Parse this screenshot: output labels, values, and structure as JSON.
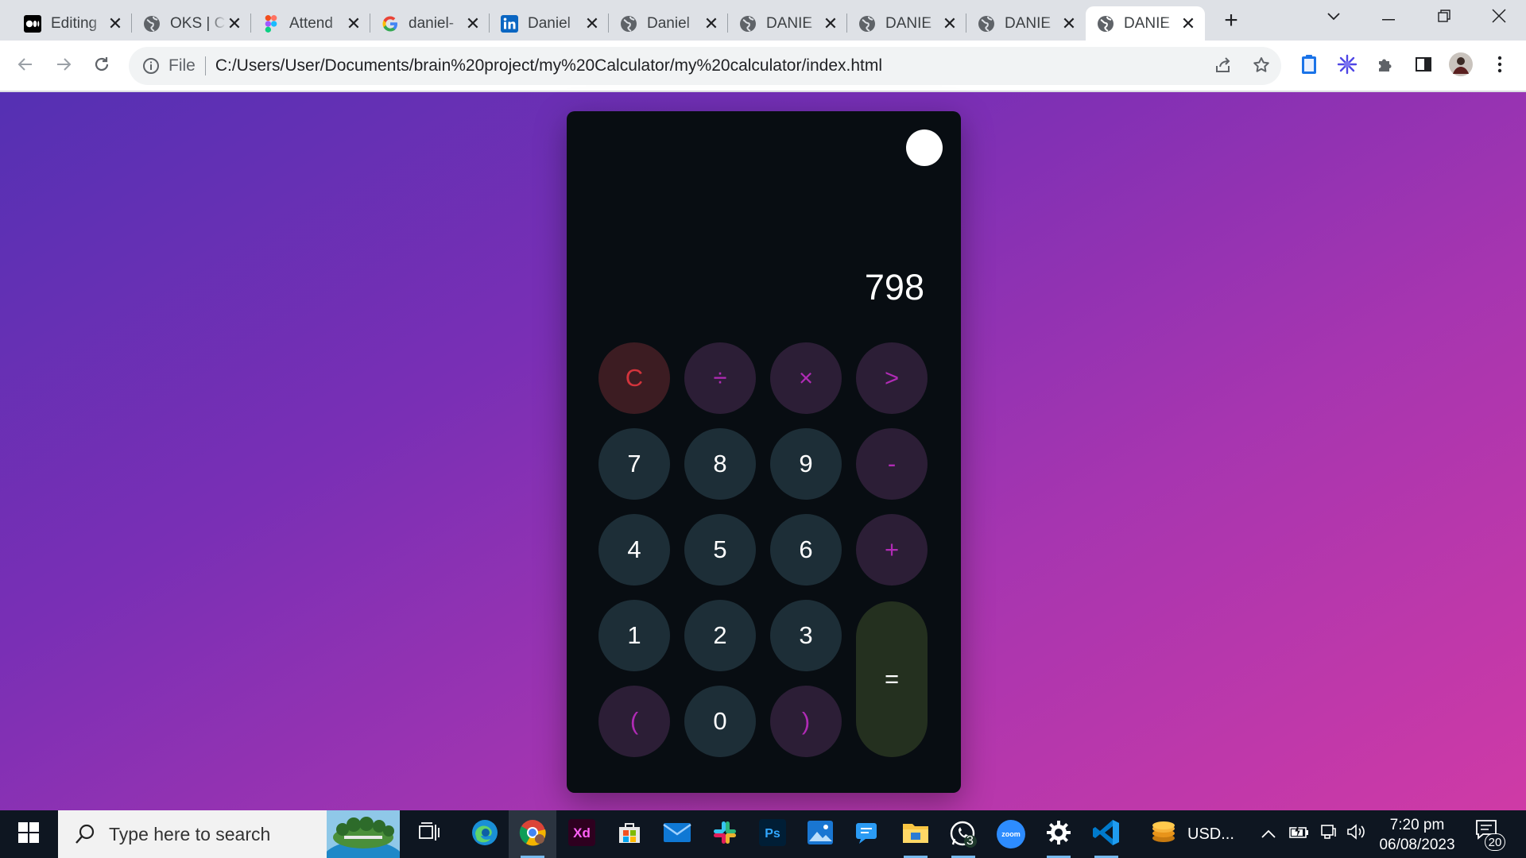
{
  "browser": {
    "tabs": [
      {
        "title": "Editing",
        "icon": "medium-icon"
      },
      {
        "title": "OKS | C",
        "icon": "globe-icon"
      },
      {
        "title": "Attend",
        "icon": "figma-icon"
      },
      {
        "title": "daniel-",
        "icon": "google-icon"
      },
      {
        "title": "Daniel",
        "icon": "linkedin-icon"
      },
      {
        "title": "Daniel",
        "icon": "globe-icon"
      },
      {
        "title": "DANIE",
        "icon": "globe-icon"
      },
      {
        "title": "DANIE",
        "icon": "globe-icon"
      },
      {
        "title": "DANIE",
        "icon": "globe-icon"
      },
      {
        "title": "DANIE",
        "icon": "globe-icon",
        "active": true
      }
    ],
    "new_tab_label": "+",
    "address": {
      "scheme_label": "File",
      "url": "C:/Users/User/Documents/brain%20project/my%20Calculator/my%20calculator/index.html"
    }
  },
  "calculator": {
    "display_value": "798",
    "keys": {
      "clear": "C",
      "divide": "÷",
      "multiply": "×",
      "backspace": ">",
      "seven": "7",
      "eight": "8",
      "nine": "9",
      "minus": "-",
      "four": "4",
      "five": "5",
      "six": "6",
      "plus": "+",
      "one": "1",
      "two": "2",
      "three": "3",
      "equals": "=",
      "open_paren": "(",
      "zero": "0",
      "close_paren": ")"
    },
    "colors": {
      "body": "#080d12",
      "number_key": "#1d2e37",
      "operator_key": "#2c1e36",
      "operator_text": "#b02bb5",
      "clear_key": "#3c1c22",
      "clear_text": "#d3343c",
      "equals_key": "#24301f"
    }
  },
  "taskbar": {
    "search_placeholder": "Type here to search",
    "pinned_apps": [
      "task-view-icon",
      "edge-icon",
      "chrome-icon",
      "adobe-xd-icon",
      "microsoft-store-icon",
      "mail-icon",
      "slack-icon",
      "photoshop-icon",
      "photos-icon",
      "feedback-icon",
      "file-explorer-icon",
      "whatsapp-icon",
      "zoom-icon",
      "settings-icon",
      "vscode-icon"
    ],
    "zoom_label": "zoom",
    "whatsapp_badge": "3",
    "currency_widget": "USD...",
    "clock_time": "7:20 pm",
    "clock_date": "06/08/2023",
    "notification_count": "20"
  }
}
